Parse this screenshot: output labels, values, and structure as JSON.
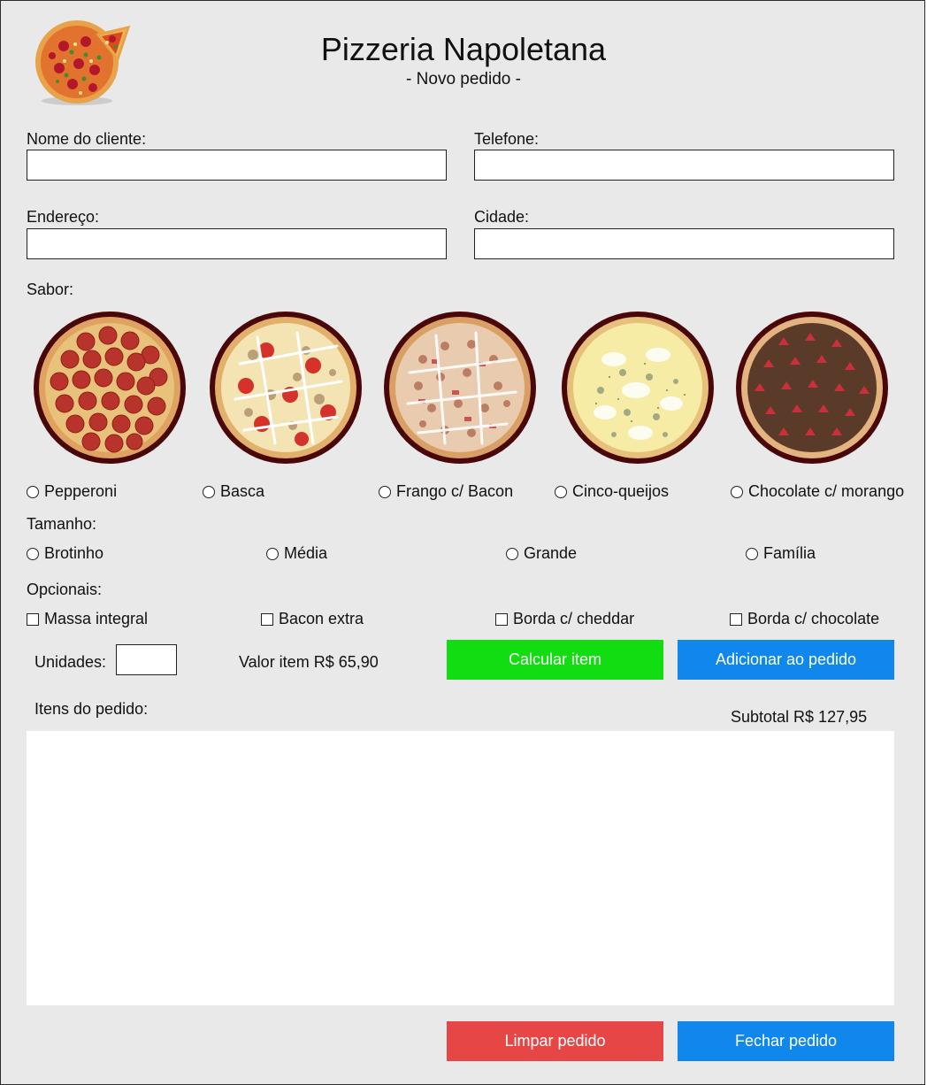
{
  "header": {
    "title": "Pizzeria Napoletana",
    "subtitle": "- Novo pedido -",
    "logo_icon": "pizza-logo-icon"
  },
  "form": {
    "nome_label": "Nome do cliente:",
    "nome_value": "",
    "telefone_label": "Telefone:",
    "telefone_value": "",
    "endereco_label": "Endereço:",
    "endereco_value": "",
    "cidade_label": "Cidade:",
    "cidade_value": ""
  },
  "sabor": {
    "label": "Sabor:",
    "options": [
      {
        "label": "Pepperoni",
        "image": "pepperoni-pizza",
        "selected": false
      },
      {
        "label": "Basca",
        "image": "basca-pizza",
        "selected": false
      },
      {
        "label": "Frango c/ Bacon",
        "image": "frango-bacon-pizza",
        "selected": false
      },
      {
        "label": "Cinco-queijos",
        "image": "cinco-queijos-pizza",
        "selected": false
      },
      {
        "label": "Chocolate c/ morango",
        "image": "chocolate-morango-pizza",
        "selected": false
      }
    ]
  },
  "tamanho": {
    "label": "Tamanho:",
    "options": [
      {
        "label": "Brotinho",
        "selected": false
      },
      {
        "label": "Média",
        "selected": false
      },
      {
        "label": "Grande",
        "selected": false
      },
      {
        "label": "Família",
        "selected": false
      }
    ]
  },
  "opcionais": {
    "label": "Opcionais:",
    "options": [
      {
        "label": "Massa integral",
        "checked": false
      },
      {
        "label": "Bacon extra",
        "checked": false
      },
      {
        "label": "Borda c/ cheddar",
        "checked": false
      },
      {
        "label": "Borda c/ chocolate",
        "checked": false
      }
    ]
  },
  "item": {
    "unidades_label": "Unidades:",
    "unidades_value": "",
    "valor_text": "Valor item R$ 65,90",
    "calcular_label": "Calcular item",
    "adicionar_label": "Adicionar ao pedido"
  },
  "pedido": {
    "itens_label": "Itens do pedido:",
    "subtotal_text": "Subtotal R$ 127,95",
    "items": [],
    "limpar_label": "Limpar pedido",
    "fechar_label": "Fechar pedido"
  },
  "colors": {
    "background": "#e9e9e9",
    "calcular_button": "#11dd11",
    "adicionar_button": "#0f87ed",
    "limpar_button": "#e64646",
    "fechar_button": "#0f87ed",
    "pizza_rim": "#4a0708"
  }
}
